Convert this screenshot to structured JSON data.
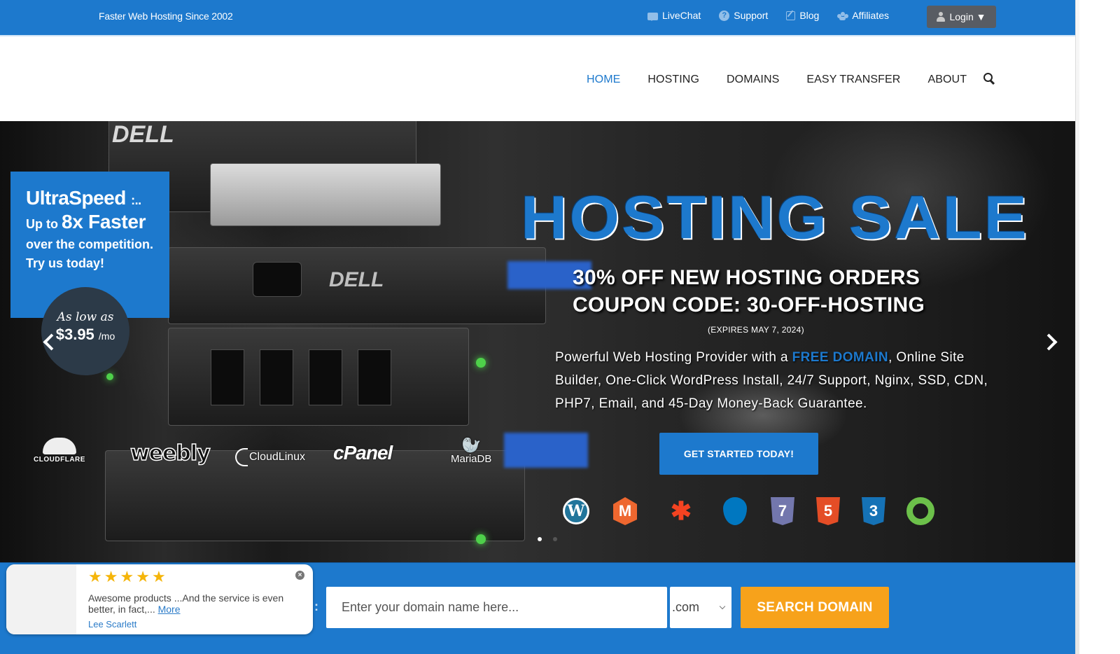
{
  "topbar": {
    "tagline": "Faster Web Hosting Since 2002",
    "links": [
      {
        "label": "LiveChat",
        "icon": "chat-icon"
      },
      {
        "label": "Support",
        "icon": "help-icon"
      },
      {
        "label": "Blog",
        "icon": "edit-icon"
      },
      {
        "label": "Affiliates",
        "icon": "users-icon"
      }
    ],
    "login_label": "Login ▼"
  },
  "nav": {
    "items": [
      "HOME",
      "HOSTING",
      "DOMAINS",
      "EASY TRANSFER",
      "ABOUT"
    ],
    "active": "HOME",
    "search_icon": "search-icon"
  },
  "hero": {
    "promo": {
      "title": "UltraSpeed",
      "title_suffix": ":..",
      "line2_prefix": "Up to",
      "line2_bold": "8x Faster",
      "line3": "over the competition.",
      "line4": "Try us today!"
    },
    "price": {
      "label": "As low as",
      "amount": "$3.95",
      "period": "/mo"
    },
    "headline": "HOSTING SALE",
    "subhead_line1": "30% OFF NEW HOSTING ORDERS",
    "subhead_line2": "COUPON CODE: 30-OFF-HOSTING",
    "expires": "(EXPIRES MAY 7, 2024)",
    "desc_before": "Powerful Web Hosting Provider with a ",
    "desc_highlight": "FREE DOMAIN",
    "desc_after": ", Online Site Builder, One-Click WordPress Install, 24/7 Support, Nginx, SSD, CDN, PHP7, Email, and 45-Day Money-Back Guarantee.",
    "cta_label": "GET STARTED TODAY!",
    "partners": [
      "CLOUDFLARE",
      "weebly",
      "CloudLinux",
      "cPanel",
      "MariaDB"
    ],
    "tech_icons": [
      {
        "name": "wordpress-icon",
        "glyph": "W",
        "color": "#21759b"
      },
      {
        "name": "magento-icon",
        "glyph": "M",
        "color": "#ee672f"
      },
      {
        "name": "joomla-icon",
        "glyph": "✱",
        "color": "#f44321"
      },
      {
        "name": "drupal-icon",
        "glyph": "💧",
        "color": "#0077c0"
      },
      {
        "name": "php7-icon",
        "glyph": "7",
        "color": "#7377ad"
      },
      {
        "name": "html5-icon",
        "glyph": "5",
        "color": "#e44d26"
      },
      {
        "name": "css3-icon",
        "glyph": "3",
        "color": "#1572b6"
      },
      {
        "name": "open-source-icon",
        "glyph": "◔",
        "color": "#6cc04a"
      }
    ],
    "slide_count": 2,
    "active_slide": 1
  },
  "review": {
    "rating": 5,
    "text": "Awesome products ...And the service is even better, in fact,... ",
    "more_label": "More",
    "author": "Lee Scarlett"
  },
  "domain_search": {
    "placeholder": "Enter your domain name here...",
    "value": "",
    "tld": ".com",
    "button_label": "SEARCH DOMAIN"
  },
  "colors": {
    "brand_blue": "#1d79cd",
    "accent_orange": "#f7a21b",
    "login_gray": "#585c63",
    "price_circle": "#2c3a48"
  }
}
